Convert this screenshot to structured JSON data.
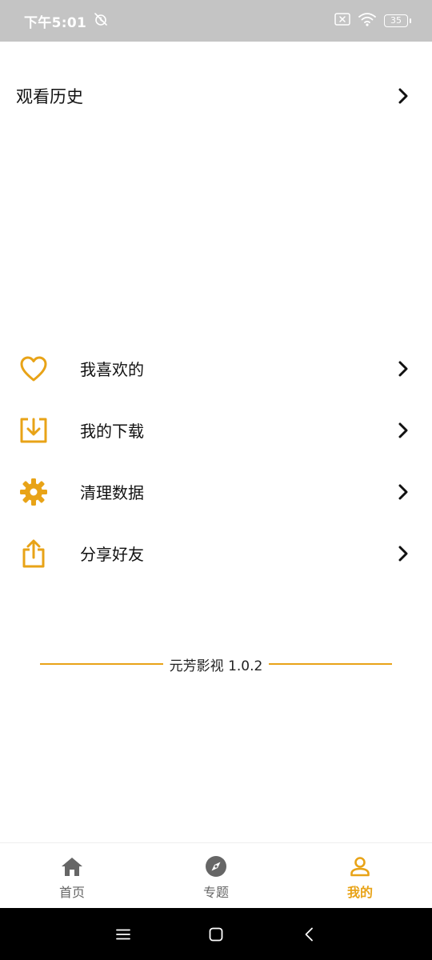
{
  "status_bar": {
    "time": "下午5:01",
    "battery": "35",
    "icons": [
      "alarm-off-icon",
      "sim-off-icon",
      "wifi-icon",
      "battery-icon"
    ]
  },
  "history": {
    "label": "观看历史",
    "chevron_icon": "chevron-right-icon"
  },
  "menu": {
    "items": [
      {
        "label": "我喜欢的",
        "icon": "heart-icon"
      },
      {
        "label": "我的下载",
        "icon": "download-icon"
      },
      {
        "label": "清理数据",
        "icon": "gear-icon"
      },
      {
        "label": "分享好友",
        "icon": "share-icon"
      }
    ]
  },
  "version": {
    "text": "元芳影视 1.0.2"
  },
  "tabs": [
    {
      "label": "首页",
      "icon": "home-icon",
      "active": false
    },
    {
      "label": "专题",
      "icon": "compass-icon",
      "active": false
    },
    {
      "label": "我的",
      "icon": "user-icon",
      "active": true
    }
  ],
  "nav": {
    "icons": [
      "menu-icon",
      "home-square-icon",
      "back-icon"
    ]
  },
  "colors": {
    "accent": "#e8a317",
    "status_bar_bg": "#c4c4c4",
    "inactive_tab": "#666666",
    "nav_bar_bg": "#000000"
  }
}
